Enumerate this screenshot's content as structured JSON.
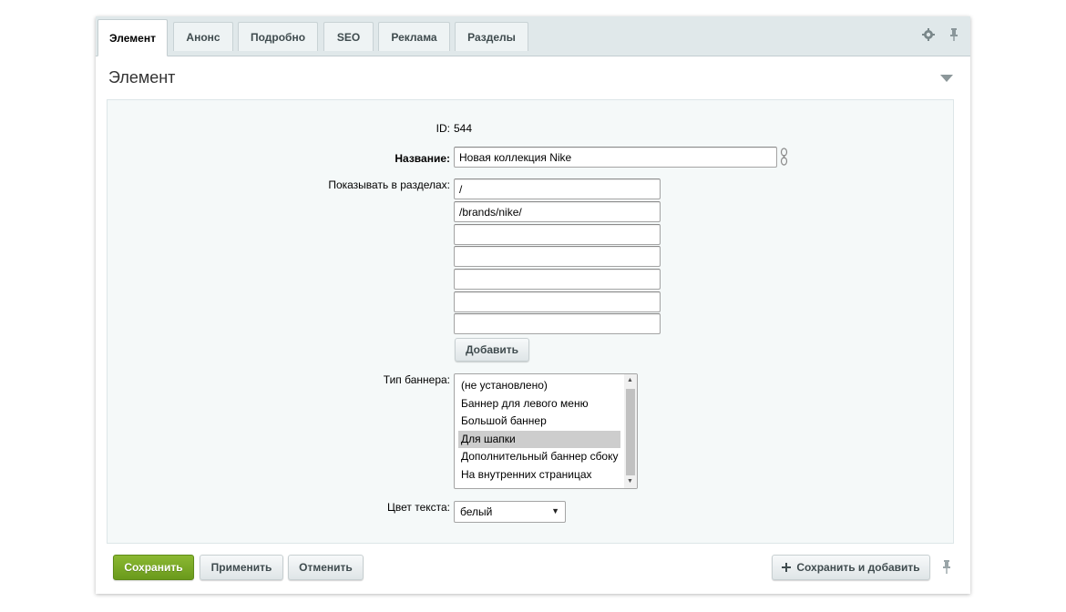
{
  "tabs": [
    {
      "label": "Элемент",
      "active": true
    },
    {
      "label": "Анонс"
    },
    {
      "label": "Подробно"
    },
    {
      "label": "SEO"
    },
    {
      "label": "Реклама"
    },
    {
      "label": "Разделы"
    }
  ],
  "tools": {
    "settings_icon": "gear-icon",
    "pin_icon": "pin-icon"
  },
  "section": {
    "title": "Элемент"
  },
  "form": {
    "id_label": "ID:",
    "id_value": "544",
    "name_label": "Название:",
    "name_value": "Новая коллекция Nike",
    "sections_label": "Показывать в разделах:",
    "sections_values": [
      "/",
      "/brands/nike/",
      "",
      "",
      "",
      "",
      ""
    ],
    "add_button": "Добавить",
    "banner_type_label": "Тип баннера:",
    "banner_type_options": [
      "(не установлено)",
      "Баннер для левого меню",
      "Большой баннер",
      "Для шапки",
      "Дополнительный баннер сбоку",
      "На внутренних страницах"
    ],
    "banner_type_selected": "Для шапки",
    "text_color_label": "Цвет текста:",
    "text_color_value": "белый"
  },
  "footer": {
    "save": "Сохранить",
    "apply": "Применить",
    "cancel": "Отменить",
    "save_and_add": "Сохранить и добавить"
  },
  "colors": {
    "accent_green": "#6f9e1f",
    "tabbar": "#e0e8ea",
    "panel": "#f5f9f9"
  }
}
